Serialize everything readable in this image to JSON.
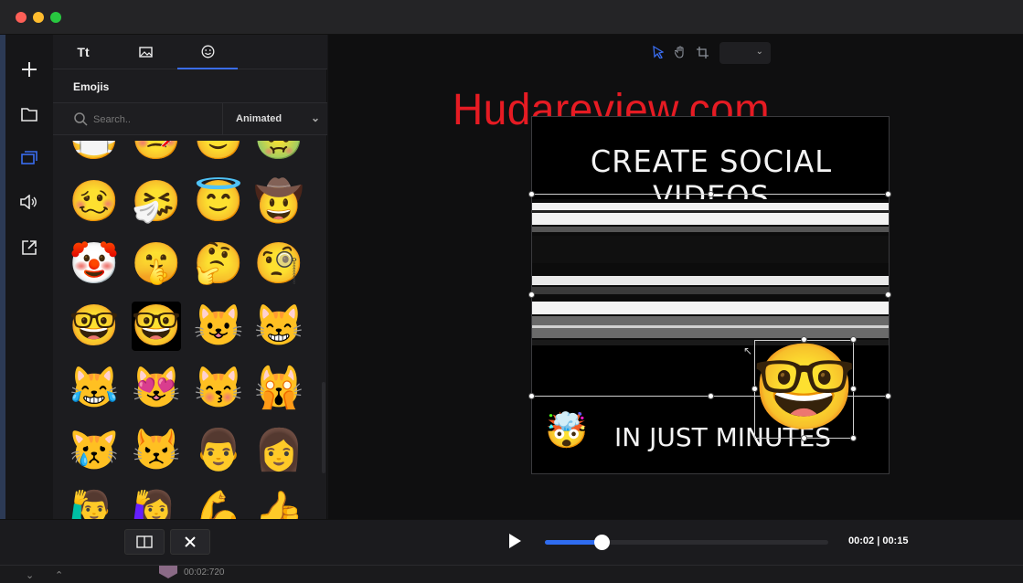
{
  "watermark": "Hudareview.com",
  "panel": {
    "tabs": [
      {
        "label": "Tt",
        "icon": "text-icon"
      },
      {
        "label": "",
        "icon": "image-icon"
      },
      {
        "label": "",
        "icon": "emoji-icon"
      }
    ],
    "section_title": "Emojis",
    "search_placeholder": "Search..",
    "filter_value": "Animated"
  },
  "emojis": [
    [
      "😷",
      "🤒",
      "🙂",
      "🤢"
    ],
    [
      "🥴",
      "🤧",
      "😇",
      "🤠"
    ],
    [
      "🤡",
      "🤫",
      "🤔",
      "🧐"
    ],
    [
      "🤓",
      "🤓",
      "😺",
      "😸"
    ],
    [
      "😹",
      "😻",
      "😽",
      "🙀"
    ],
    [
      "😿",
      "😾",
      "👨",
      "👩"
    ],
    [
      "🙋‍♂️",
      "🙋‍♀️",
      "💪",
      "👍"
    ]
  ],
  "selected_emoji_index": [
    3,
    1
  ],
  "video": {
    "headline": "CREATE SOCIAL VIDEOS",
    "subline": "IN JUST MINUTES",
    "small_emoji": "🤯",
    "overlay_emoji": "🤓"
  },
  "playback": {
    "current_time": "00:02",
    "duration": "00:15",
    "timecode": "00:02 | 00:15",
    "progress": 0.2
  },
  "timeline": {
    "marker_time": "00:02:720"
  },
  "colors": {
    "accent": "#2f6cf0",
    "watermark": "#e61b23"
  }
}
